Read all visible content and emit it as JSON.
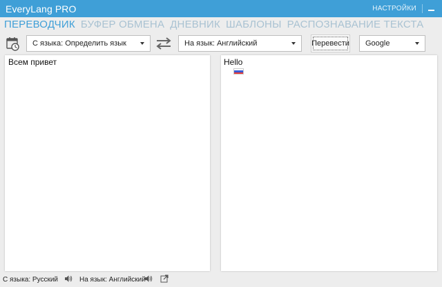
{
  "window": {
    "title": "EveryLang PRO",
    "settings_label": "НАСТРОЙКИ"
  },
  "tabs": [
    {
      "label": "ПЕРЕВОДЧИК",
      "active": true
    },
    {
      "label": "БУФЕР ОБМЕНА",
      "active": false
    },
    {
      "label": "ДНЕВНИК",
      "active": false
    },
    {
      "label": "ШАБЛОНЫ",
      "active": false
    },
    {
      "label": "РАСПОЗНАВАНИЕ ТЕКСТА",
      "active": false
    }
  ],
  "toolbar": {
    "from_language": "С языка: Определить язык",
    "to_language": "На язык: Английский",
    "translate_button": "Перевести",
    "engine": "Google"
  },
  "source": {
    "text": "Всем привет"
  },
  "result": {
    "text": "Hello",
    "detected_flag": "russian-flag-icon"
  },
  "status": {
    "from": "С языка: Русский",
    "to": "На язык: Английский"
  },
  "colors": {
    "accent": "#3f9fd7",
    "tab_inactive": "#a9c2d2",
    "background": "#ededed"
  }
}
